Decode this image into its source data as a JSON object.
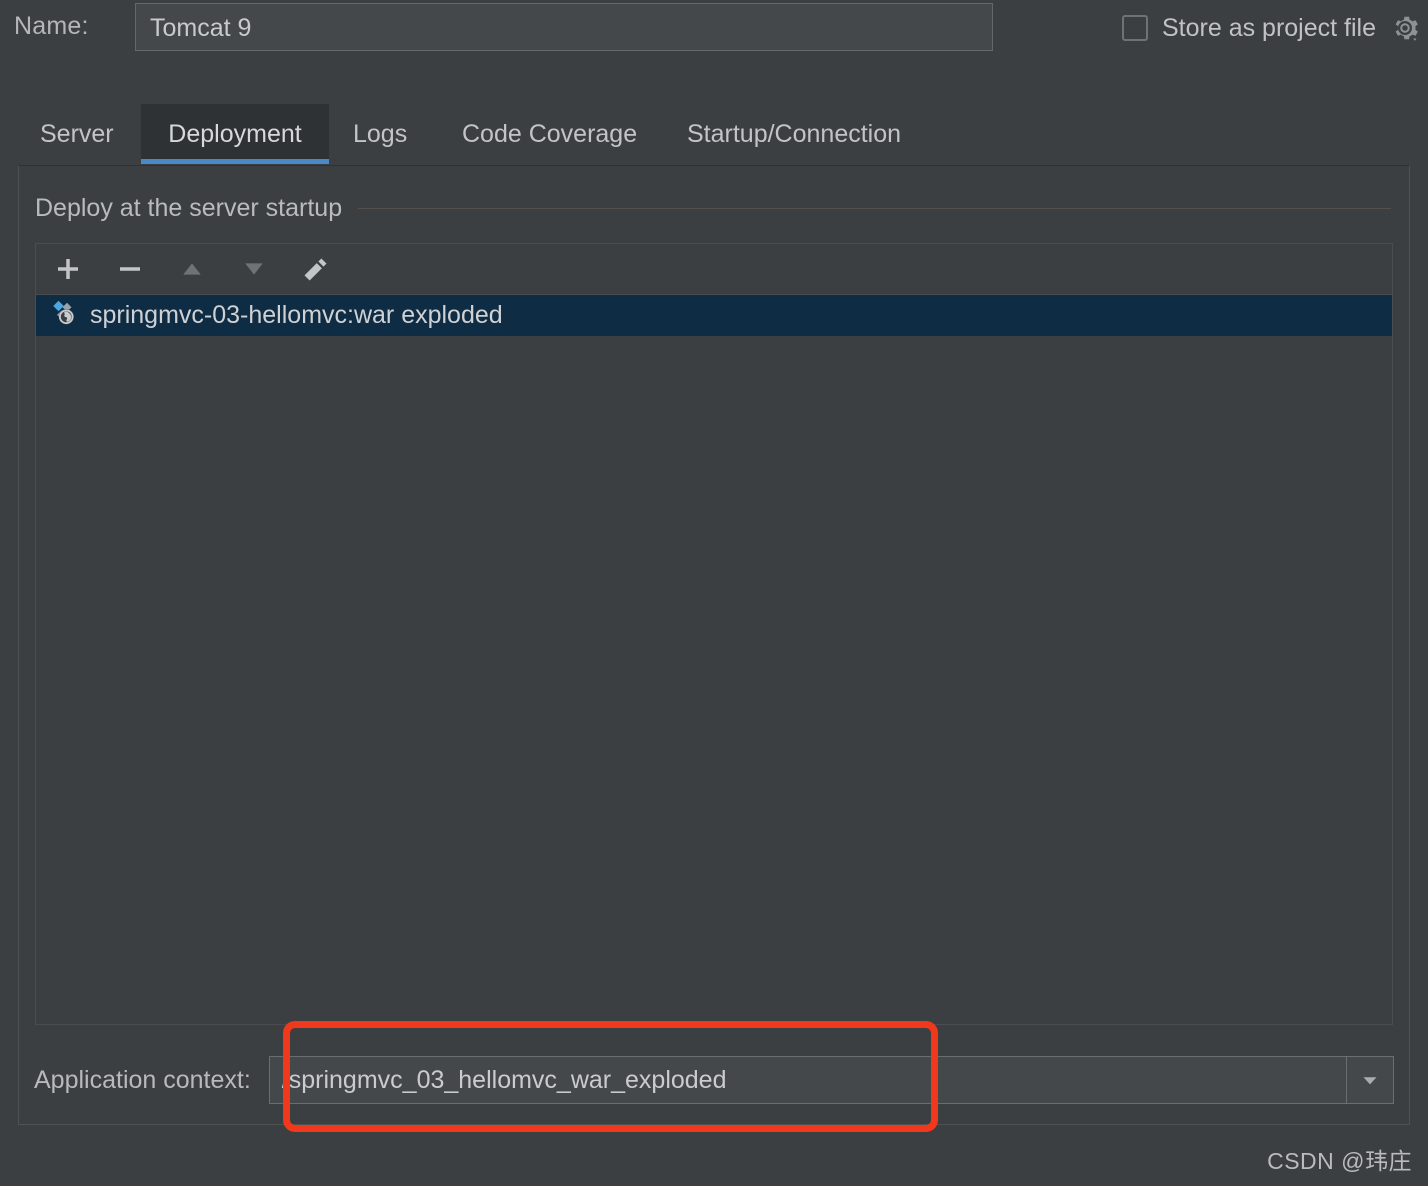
{
  "header": {
    "name_label": "Name:",
    "name_value": "Tomcat 9",
    "store_as_project_file_label": "Store as project file",
    "store_as_project_file_checked": false,
    "gear_icon": "gear-icon"
  },
  "tabs": [
    {
      "label": "Server",
      "selected": false
    },
    {
      "label": "Deployment",
      "selected": true
    },
    {
      "label": "Logs",
      "selected": false
    },
    {
      "label": "Code Coverage",
      "selected": false
    },
    {
      "label": "Startup/Connection",
      "selected": false
    }
  ],
  "deployment": {
    "section_title": "Deploy at the server startup",
    "toolbar": [
      {
        "icon": "plus-icon",
        "label": "Add",
        "enabled": true
      },
      {
        "icon": "minus-icon",
        "label": "Remove",
        "enabled": true
      },
      {
        "icon": "arrow-up-icon",
        "label": "Move Up",
        "enabled": false
      },
      {
        "icon": "arrow-down-icon",
        "label": "Move Down",
        "enabled": false
      },
      {
        "icon": "pencil-edit-icon",
        "label": "Edit",
        "enabled": true
      }
    ],
    "artifacts": [
      {
        "icon": "artifact-war-exploded-icon",
        "label": "springmvc-03-hellomvc:war exploded",
        "selected": true
      }
    ],
    "application_context_label": "Application context:",
    "application_context_value": "/springmvc_03_hellomvc_war_exploded",
    "dropdown_icon": "chevron-down-icon"
  },
  "annotation": {
    "shape": "rounded-rectangle",
    "color": "#f0391c",
    "target": "application-context-field"
  },
  "watermark": "CSDN @玮庄",
  "colors": {
    "background": "#3c3f41",
    "field_background": "#45484a",
    "selected_row": "#0e2c44",
    "tab_accent": "#4a88c8",
    "selected_tab_background": "#2f3234",
    "text": "#bbbbbb",
    "annotation_red": "#f0391c"
  }
}
